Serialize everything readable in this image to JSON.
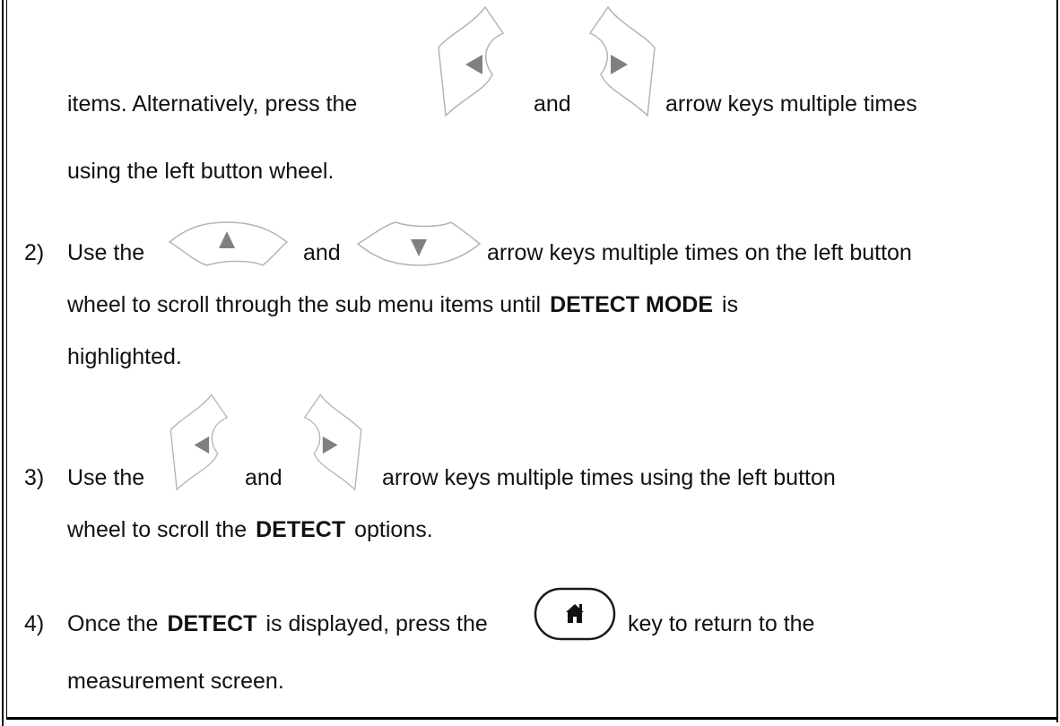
{
  "intro": {
    "line1_pre": "items.  Alternatively, press the",
    "line1_and": "and",
    "line1_post": "arrow keys multiple times",
    "line2": "using the left button wheel."
  },
  "steps": [
    {
      "number": "2)",
      "line1_pre": "Use the",
      "line1_and": "and",
      "line1_post": "arrow keys multiple times on the left button",
      "line2_pre": "wheel to scroll through the sub menu items until",
      "line2_bold": "DETECT MODE",
      "line2_post": "is",
      "line3": "highlighted."
    },
    {
      "number": "3)",
      "line1_pre": "Use the",
      "line1_and": "and",
      "line1_post": "arrow keys multiple times using the left button",
      "line2_pre": "wheel to scroll the",
      "line2_bold": "DETECT",
      "line2_post": "options."
    },
    {
      "number": "4)",
      "line1_pre": "Once the",
      "line1_bold": "DETECT",
      "line1_mid": "is displayed, press the",
      "line1_post": "key to return to the",
      "line2": "measurement screen."
    }
  ],
  "icons": {
    "left_key": "left-arrow-key-icon",
    "right_key": "right-arrow-key-icon",
    "up_key": "up-arrow-key-icon",
    "down_key": "down-arrow-key-icon",
    "home_key": "home-key-icon"
  },
  "colors": {
    "text": "#111111",
    "key_outline": "#b4b4b4",
    "key_arrow": "#808080",
    "frame": "#000000"
  }
}
